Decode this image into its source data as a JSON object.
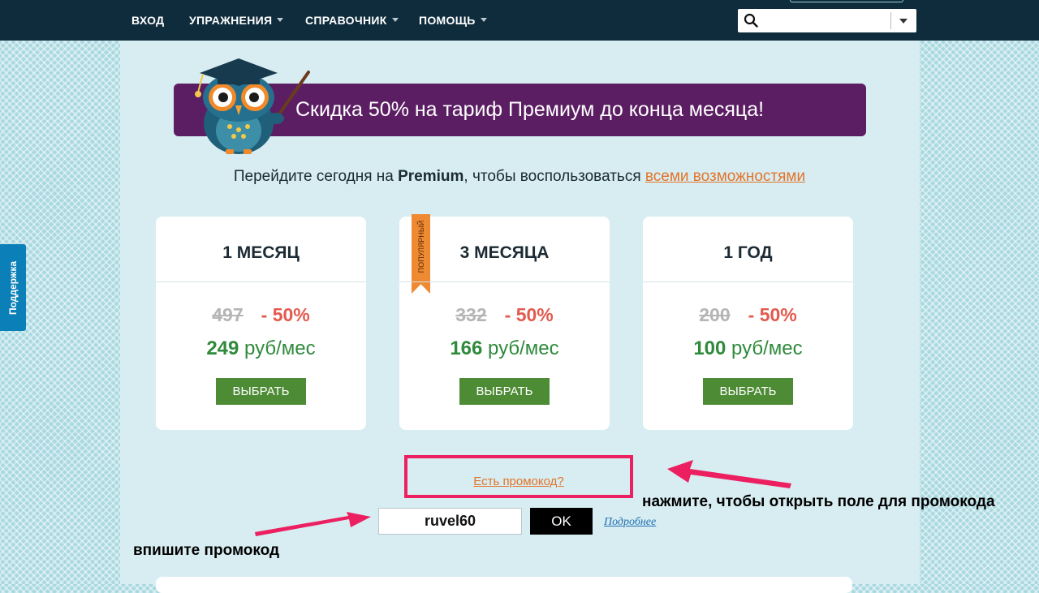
{
  "nav": {
    "items": [
      {
        "label": "ВХОД",
        "has_dropdown": false
      },
      {
        "label": "УПРАЖНЕНИЯ",
        "has_dropdown": true
      },
      {
        "label": "СПРАВОЧНИК",
        "has_dropdown": true
      },
      {
        "label": "ПОМОЩЬ",
        "has_dropdown": true
      }
    ],
    "search": {
      "value": "",
      "icon": "search-icon"
    }
  },
  "support_tab": {
    "label": "Поддержка"
  },
  "banner": {
    "text": "Скидка 50% на тариф Премиум до конца месяца!",
    "color": "#5b1e63"
  },
  "subhead": {
    "prefix": "Перейдите сегодня на ",
    "bold": "Premium",
    "middle": ", чтобы воспользоваться ",
    "link": "всеми возможностями"
  },
  "plans": [
    {
      "title": "1 МЕСЯЦ",
      "old_price": "497",
      "discount": "- 50%",
      "new_price": "249",
      "unit": "руб/мес",
      "button": "ВЫБРАТЬ"
    },
    {
      "title": "3 МЕСЯЦА",
      "old_price": "332",
      "discount": "- 50%",
      "new_price": "166",
      "unit": "руб/мес",
      "button": "ВЫБРАТЬ",
      "ribbon": "ПОПУЛЯРНЫЙ"
    },
    {
      "title": "1 ГОД",
      "old_price": "200",
      "discount": "- 50%",
      "new_price": "100",
      "unit": "руб/мес",
      "button": "ВЫБРАТЬ"
    }
  ],
  "promo": {
    "link": "Есть промокод?",
    "code": "ruvel60",
    "ok": "OK",
    "more": "Подробнее"
  },
  "hints": {
    "open_field": "нажмите, чтобы открыть поле для промокода",
    "enter_code": "впишите промокод"
  },
  "colors": {
    "accent": "#e3742a",
    "button": "#4d8b35",
    "price": "#2f8a3c",
    "discount": "#e25a4d",
    "highlight": "#ec1f61"
  }
}
